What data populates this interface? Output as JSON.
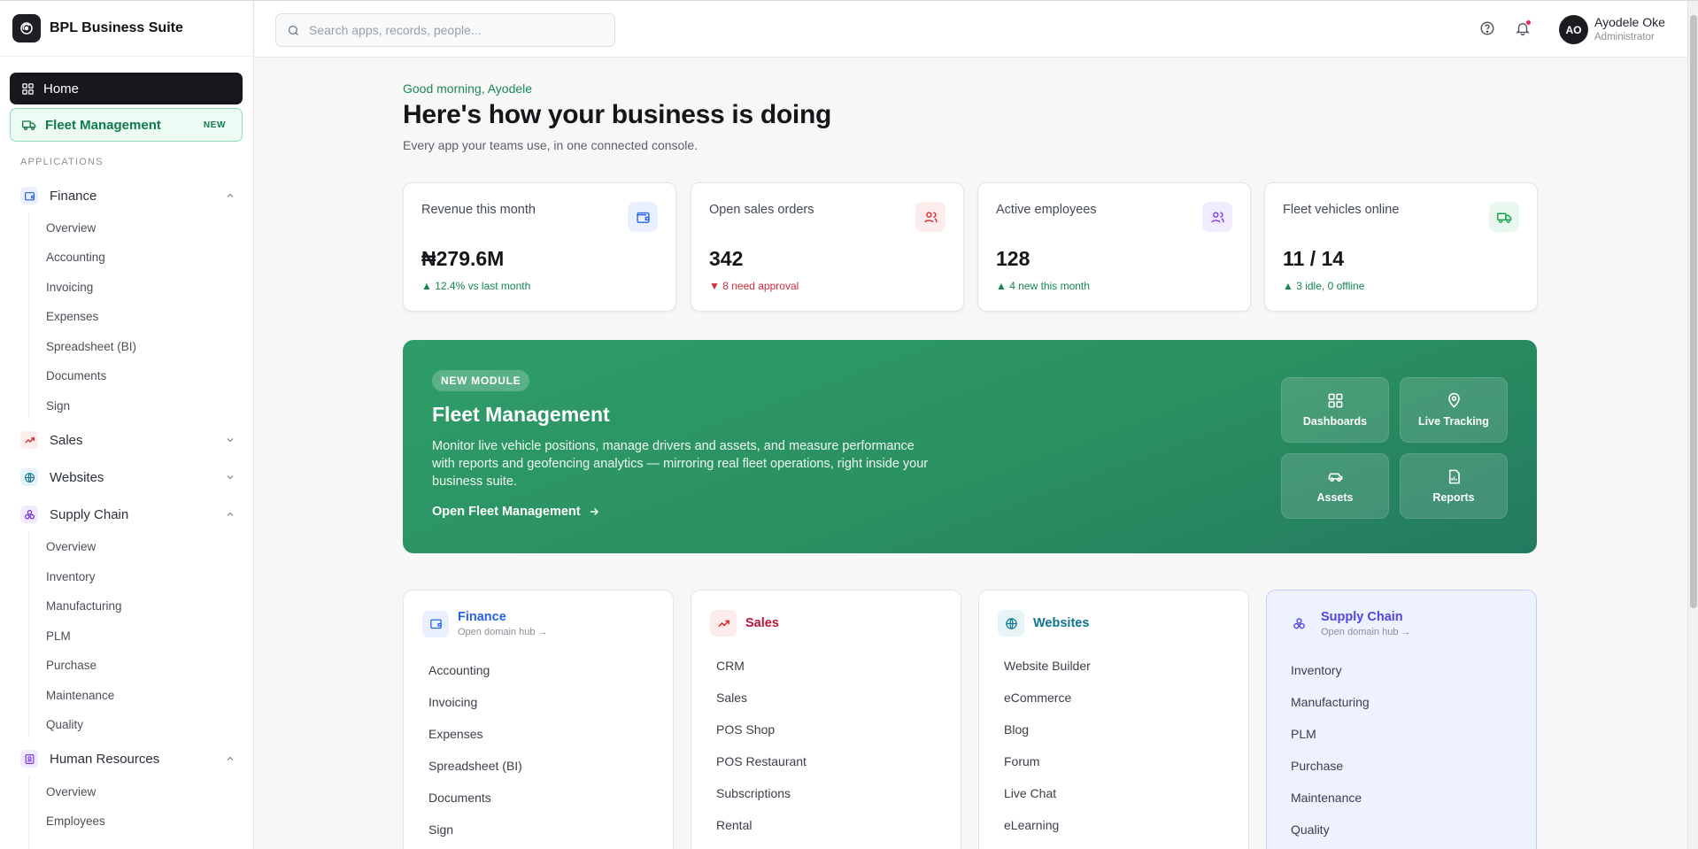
{
  "app": {
    "name": "BPL Business Suite"
  },
  "sidebar": {
    "home_label": "Home",
    "fleet": {
      "label": "Fleet Management",
      "badge": "NEW"
    },
    "section_label": "APPLICATIONS",
    "groups": [
      {
        "label": "Finance",
        "expanded": true,
        "color": "#2563eb",
        "items": [
          "Overview",
          "Accounting",
          "Invoicing",
          "Expenses",
          "Spreadsheet (BI)",
          "Documents",
          "Sign"
        ]
      },
      {
        "label": "Sales",
        "expanded": false,
        "color": "#dc2626",
        "items": []
      },
      {
        "label": "Websites",
        "expanded": false,
        "color": "#0e7490",
        "items": []
      },
      {
        "label": "Supply Chain",
        "expanded": true,
        "color": "#6d28d9",
        "items": [
          "Overview",
          "Inventory",
          "Manufacturing",
          "PLM",
          "Purchase",
          "Maintenance",
          "Quality"
        ]
      },
      {
        "label": "Human Resources",
        "expanded": true,
        "color": "#7c3aed",
        "items": [
          "Overview",
          "Employees"
        ]
      }
    ]
  },
  "header": {
    "search_placeholder": "Search apps, records, people...",
    "user": {
      "initials": "AO",
      "name": "Ayodele Oke",
      "role": "Administrator"
    }
  },
  "main": {
    "greeting": "Good morning, Ayodele",
    "title": "Here's how your business is doing",
    "subtitle": "Every app your teams use, in one connected console.",
    "kpis": [
      {
        "label": "Revenue this month",
        "value": "₦279.6M",
        "delta": "▲ 12.4% vs last month",
        "trend": "up",
        "icon": "wallet-icon",
        "color": "#2563eb",
        "bg": "#eaf0ff"
      },
      {
        "label": "Open sales orders",
        "value": "342",
        "delta": "▼ 8 need approval",
        "trend": "down",
        "icon": "users-icon",
        "color": "#dc2626",
        "bg": "#fdecec"
      },
      {
        "label": "Active employees",
        "value": "128",
        "delta": "▲ 4 new this month",
        "trend": "up",
        "icon": "users-icon",
        "color": "#7c3aed",
        "bg": "#f1ebff"
      },
      {
        "label": "Fleet vehicles online",
        "value": "11 / 14",
        "delta": "▲ 3 idle, 0 offline",
        "trend": "up",
        "icon": "truck-icon",
        "color": "#16a34a",
        "bg": "#e8f8ef"
      }
    ],
    "banner": {
      "badge": "NEW MODULE",
      "title": "Fleet Management",
      "description": "Monitor live vehicle positions, manage drivers and assets, and measure performance with reports and geofencing analytics — mirroring real fleet operations, right inside your business suite.",
      "link": "Open Fleet Management",
      "tiles": [
        "Dashboards",
        "Live Tracking",
        "Assets",
        "Reports"
      ]
    },
    "domains": [
      {
        "name": "Finance",
        "hub": "Open domain hub →",
        "color": "#2563eb",
        "items": [
          "Accounting",
          "Invoicing",
          "Expenses",
          "Spreadsheet (BI)",
          "Documents",
          "Sign"
        ]
      },
      {
        "name": "Sales",
        "hub": "",
        "color": "#be123c",
        "items": [
          "CRM",
          "Sales",
          "POS Shop",
          "POS Restaurant",
          "Subscriptions",
          "Rental"
        ]
      },
      {
        "name": "Websites",
        "hub": "",
        "color": "#0e7490",
        "items": [
          "Website Builder",
          "eCommerce",
          "Blog",
          "Forum",
          "Live Chat",
          "eLearning"
        ]
      },
      {
        "name": "Supply Chain",
        "hub": "Open domain hub →",
        "color": "#4f46e5",
        "items": [
          "Inventory",
          "Manufacturing",
          "PLM",
          "Purchase",
          "Maintenance",
          "Quality"
        ]
      }
    ]
  }
}
